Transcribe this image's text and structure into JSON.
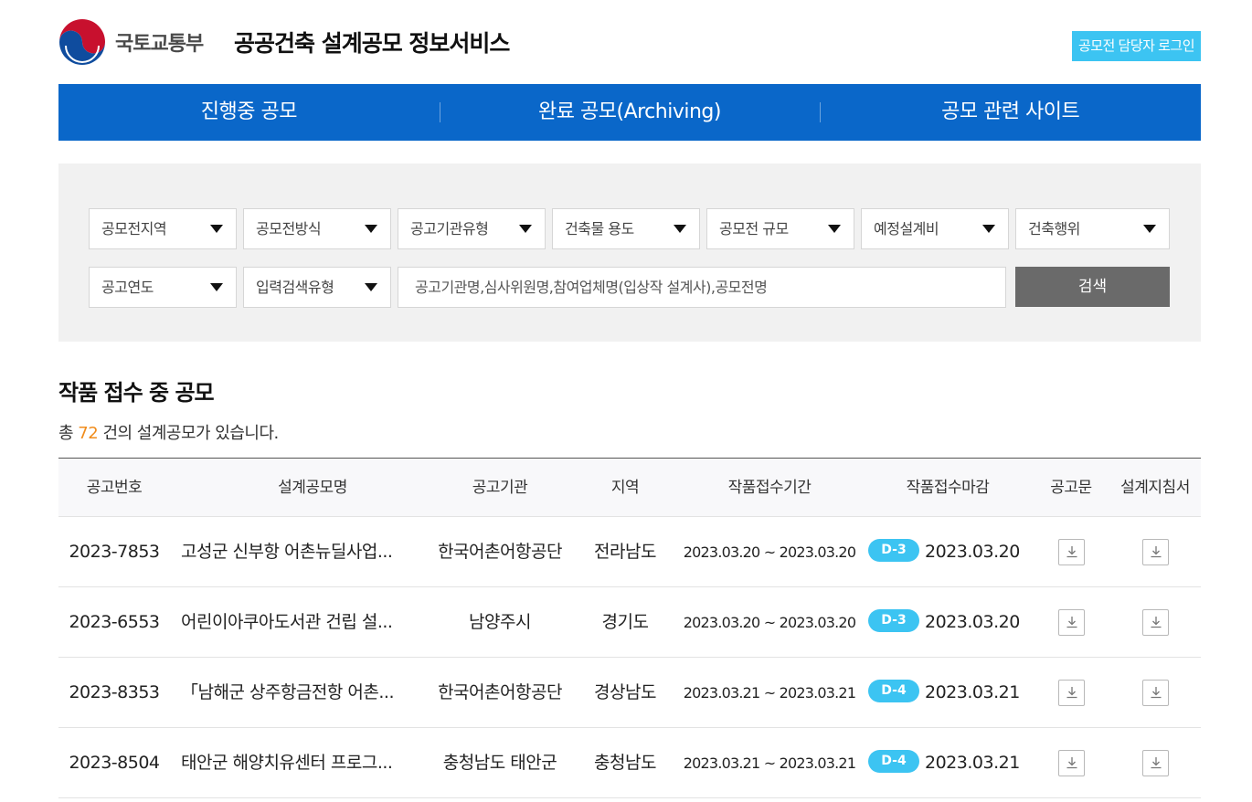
{
  "header": {
    "ministry": "국토교통부",
    "title": "공공건축 설계공모 정보서비스",
    "login_button": "공모전 담당자 로그인"
  },
  "nav": {
    "items": [
      {
        "label": "진행중 공모"
      },
      {
        "label": "완료 공모(Archiving)"
      },
      {
        "label": "공모 관련 사이트"
      }
    ]
  },
  "filters": {
    "row1": [
      "공모전지역",
      "공모전방식",
      "공고기관유형",
      "건축물 용도",
      "공모전 규모",
      "예정설계비",
      "건축행위"
    ],
    "row2": [
      "공고연도",
      "입력검색유형"
    ],
    "search_placeholder": "공고기관명,심사위원명,참여업체명(입상작 설계사),공모전명",
    "search_button": "검색"
  },
  "section": {
    "title": "작품 접수 중 공모",
    "count_prefix": "총",
    "count": "72",
    "count_suffix": "건의 설계공모가 있습니다."
  },
  "table": {
    "columns": [
      "공고번호",
      "설계공모명",
      "공고기관",
      "지역",
      "작품접수기간",
      "작품접수마감",
      "공고문",
      "설계지침서"
    ],
    "rows": [
      {
        "id": "2023-7853",
        "name": "고성군 신부항 어촌뉴딜사업...",
        "agency": "한국어촌어항공단",
        "region": "전라남도",
        "period": "2023.03.20 ~ 2023.03.20",
        "dday": "D-3",
        "deadline": "2023.03.20"
      },
      {
        "id": "2023-6553",
        "name": "어린이아쿠아도서관 건립 설...",
        "agency": "남양주시",
        "region": "경기도",
        "period": "2023.03.20 ~ 2023.03.20",
        "dday": "D-3",
        "deadline": "2023.03.20"
      },
      {
        "id": "2023-8353",
        "name": "「남해군 상주항금전항 어촌...",
        "agency": "한국어촌어항공단",
        "region": "경상남도",
        "period": "2023.03.21 ~ 2023.03.21",
        "dday": "D-4",
        "deadline": "2023.03.21"
      },
      {
        "id": "2023-8504",
        "name": "태안군 해양치유센터 프로그...",
        "agency": "충청남도 태안군",
        "region": "충청남도",
        "period": "2023.03.21 ~ 2023.03.21",
        "dday": "D-4",
        "deadline": "2023.03.21"
      }
    ]
  },
  "colors": {
    "nav_blue": "#0a67c9",
    "accent_cyan": "#3cc4f2",
    "count_orange": "#f08c1c",
    "search_button_gray": "#6a6a6a"
  }
}
